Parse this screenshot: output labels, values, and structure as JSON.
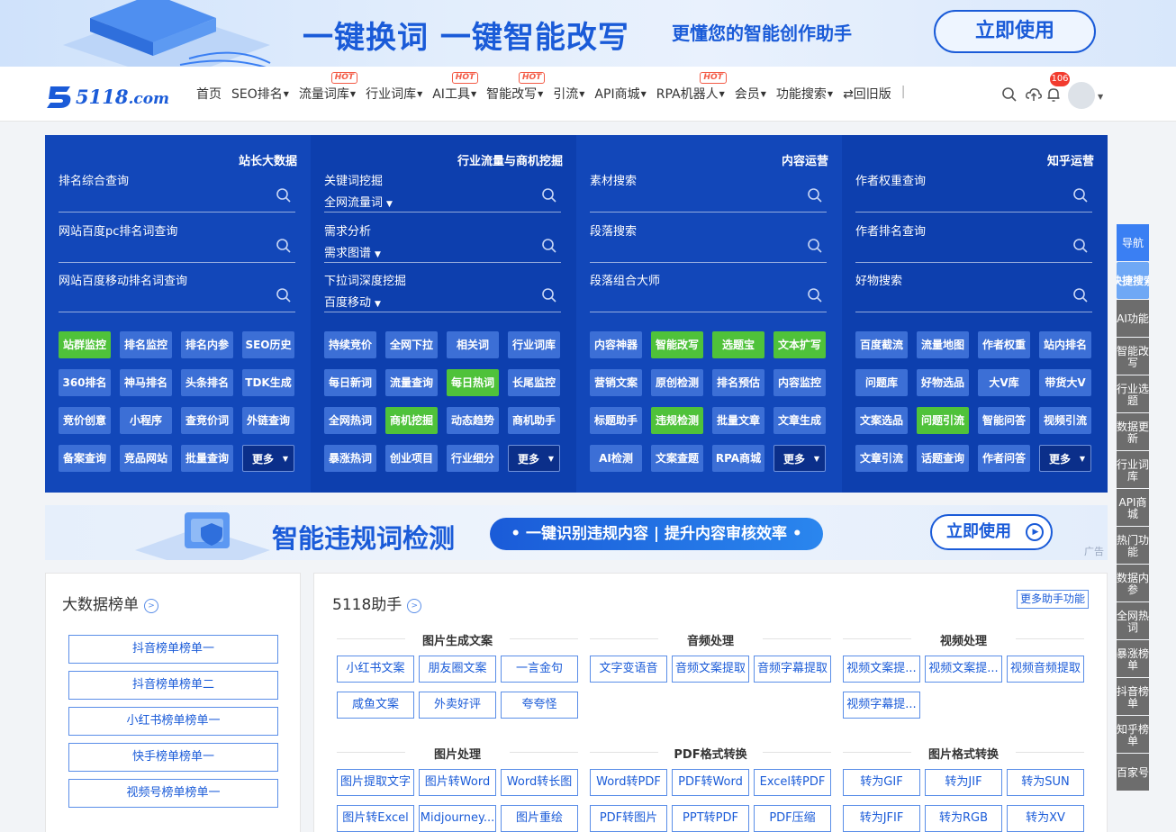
{
  "top_banner": {
    "headline": "一键换词 一键智能改写",
    "subline": "更懂您的智能创作助手",
    "cta": "立即使用"
  },
  "logo": {
    "text": "5118",
    "suffix": ".com"
  },
  "nav": {
    "items": [
      {
        "label": "首页",
        "caret": false,
        "hot": false
      },
      {
        "label": "SEO排名",
        "caret": true,
        "hot": false
      },
      {
        "label": "流量词库",
        "caret": true,
        "hot": true
      },
      {
        "label": "行业词库",
        "caret": true,
        "hot": false
      },
      {
        "label": "AI工具",
        "caret": true,
        "hot": true
      },
      {
        "label": "智能改写",
        "caret": true,
        "hot": true
      },
      {
        "label": "引流",
        "caret": true,
        "hot": false
      },
      {
        "label": "API商城",
        "caret": true,
        "hot": false
      },
      {
        "label": "RPA机器人",
        "caret": true,
        "hot": true
      },
      {
        "label": "会员",
        "caret": true,
        "hot": false
      },
      {
        "label": "功能搜索",
        "caret": true,
        "hot": false
      }
    ],
    "hot_label": "HOT",
    "old_version": "⇄回旧版",
    "notification_count": "106"
  },
  "panel": {
    "columns": [
      {
        "title": "站长大数据",
        "searches": [
          {
            "label": "排名综合查询",
            "sub": ""
          },
          {
            "label": "网站百度pc排名词查询",
            "sub": ""
          },
          {
            "label": "网站百度移动排名词查询",
            "sub": ""
          }
        ],
        "buttons": [
          {
            "label": "站群监控",
            "green": true
          },
          {
            "label": "排名监控",
            "green": false
          },
          {
            "label": "排名内参",
            "green": false
          },
          {
            "label": "SEO历史",
            "green": false
          },
          {
            "label": "360排名",
            "green": false
          },
          {
            "label": "神马排名",
            "green": false
          },
          {
            "label": "头条排名",
            "green": false
          },
          {
            "label": "TDK生成",
            "green": false
          },
          {
            "label": "竞价创意",
            "green": false
          },
          {
            "label": "小程序",
            "green": false
          },
          {
            "label": "查竞价词",
            "green": false
          },
          {
            "label": "外链查询",
            "green": false
          },
          {
            "label": "备案查询",
            "green": false
          },
          {
            "label": "竞品网站",
            "green": false
          },
          {
            "label": "批量查询",
            "green": false
          }
        ]
      },
      {
        "title": "行业流量与商机挖掘",
        "searches": [
          {
            "label": "关键词挖掘",
            "sub": "全网流量词"
          },
          {
            "label": "需求分析",
            "sub": "需求图谱"
          },
          {
            "label": "下拉词深度挖掘",
            "sub": "百度移动"
          }
        ],
        "buttons": [
          {
            "label": "持续竞价",
            "green": false
          },
          {
            "label": "全网下拉",
            "green": false
          },
          {
            "label": "相关词",
            "green": false
          },
          {
            "label": "行业词库",
            "green": false
          },
          {
            "label": "每日新词",
            "green": false
          },
          {
            "label": "流量查询",
            "green": false
          },
          {
            "label": "每日热词",
            "green": true
          },
          {
            "label": "长尾监控",
            "green": false
          },
          {
            "label": "全网热词",
            "green": false
          },
          {
            "label": "商机挖掘",
            "green": true
          },
          {
            "label": "动态趋势",
            "green": false
          },
          {
            "label": "商机助手",
            "green": false
          },
          {
            "label": "暴涨热词",
            "green": false
          },
          {
            "label": "创业项目",
            "green": false
          },
          {
            "label": "行业细分",
            "green": false
          }
        ]
      },
      {
        "title": "内容运营",
        "searches": [
          {
            "label": "素材搜索",
            "sub": ""
          },
          {
            "label": "段落搜索",
            "sub": ""
          },
          {
            "label": "段落组合大师",
            "sub": ""
          }
        ],
        "buttons": [
          {
            "label": "内容神器",
            "green": false
          },
          {
            "label": "智能改写",
            "green": true
          },
          {
            "label": "选题宝",
            "green": true
          },
          {
            "label": "文本扩写",
            "green": true
          },
          {
            "label": "营销文案",
            "green": false
          },
          {
            "label": "原创检测",
            "green": false
          },
          {
            "label": "排名预估",
            "green": false
          },
          {
            "label": "内容监控",
            "green": false
          },
          {
            "label": "标题助手",
            "green": false
          },
          {
            "label": "违规检测",
            "green": true
          },
          {
            "label": "批量文章",
            "green": false
          },
          {
            "label": "文章生成",
            "green": false
          },
          {
            "label": "AI检测",
            "green": false
          },
          {
            "label": "文案查题",
            "green": false
          },
          {
            "label": "RPA商城",
            "green": false
          }
        ]
      },
      {
        "title": "知乎运营",
        "searches": [
          {
            "label": "作者权重查询",
            "sub": ""
          },
          {
            "label": "作者排名查询",
            "sub": ""
          },
          {
            "label": "好物搜索",
            "sub": ""
          }
        ],
        "buttons": [
          {
            "label": "百度截流",
            "green": false
          },
          {
            "label": "流量地图",
            "green": false
          },
          {
            "label": "作者权重",
            "green": false
          },
          {
            "label": "站内排名",
            "green": false
          },
          {
            "label": "问题库",
            "green": false
          },
          {
            "label": "好物选品",
            "green": false
          },
          {
            "label": "大V库",
            "green": false
          },
          {
            "label": "带货大V",
            "green": false
          },
          {
            "label": "文案选品",
            "green": false
          },
          {
            "label": "问题引流",
            "green": true
          },
          {
            "label": "智能问答",
            "green": false
          },
          {
            "label": "视频引流",
            "green": false
          },
          {
            "label": "文章引流",
            "green": false
          },
          {
            "label": "话题查询",
            "green": false
          },
          {
            "label": "作者问答",
            "green": false
          }
        ]
      }
    ],
    "more_label": "更多"
  },
  "ad_banner": {
    "headline": "智能违规词检测",
    "pill": "• 一键识别违规内容 | 提升内容审核效率 •",
    "cta": "立即使用",
    "ad_label": "广告"
  },
  "bigdata": {
    "title": "大数据榜单",
    "items": [
      "抖音榜单榜单一",
      "抖音榜单榜单二",
      "小红书榜单榜单一",
      "快手榜单榜单一",
      "视频号榜单榜单一"
    ]
  },
  "assistant": {
    "title": "5118助手",
    "more": "更多助手功能",
    "groups": [
      {
        "title": "图片生成文案",
        "items": [
          "小红书文案",
          "朋友圈文案",
          "一言金句",
          "咸鱼文案",
          "外卖好评",
          "夸夸怪"
        ]
      },
      {
        "title": "音频处理",
        "items": [
          "文字变语音",
          "音频文案提取",
          "音频字幕提取"
        ]
      },
      {
        "title": "视频处理",
        "items": [
          "视频文案提...",
          "视频文案提...",
          "视频音频提取",
          "视频字幕提..."
        ]
      },
      {
        "title": "图片处理",
        "items": [
          "图片提取文字",
          "图片转Word",
          "Word转长图",
          "图片转Excel",
          "Midjourney...",
          "图片重绘"
        ]
      },
      {
        "title": "PDF格式转换",
        "items": [
          "Word转PDF",
          "PDF转Word",
          "Excel转PDF",
          "PDF转图片",
          "PPT转PDF",
          "PDF压缩"
        ]
      },
      {
        "title": "图片格式转换",
        "items": [
          "转为GIF",
          "转为JIF",
          "转为SUN",
          "转为JFIF",
          "转为RGB",
          "转为XV"
        ]
      }
    ]
  },
  "side_nav": [
    "导航",
    "快捷搜索",
    "AI功能",
    "智能改写",
    "行业选题",
    "数据更新",
    "行业词库",
    "API商城",
    "热门功能",
    "数据内参",
    "全网热词",
    "暴涨榜单",
    "抖音榜单",
    "知乎榜单",
    "百家号"
  ]
}
